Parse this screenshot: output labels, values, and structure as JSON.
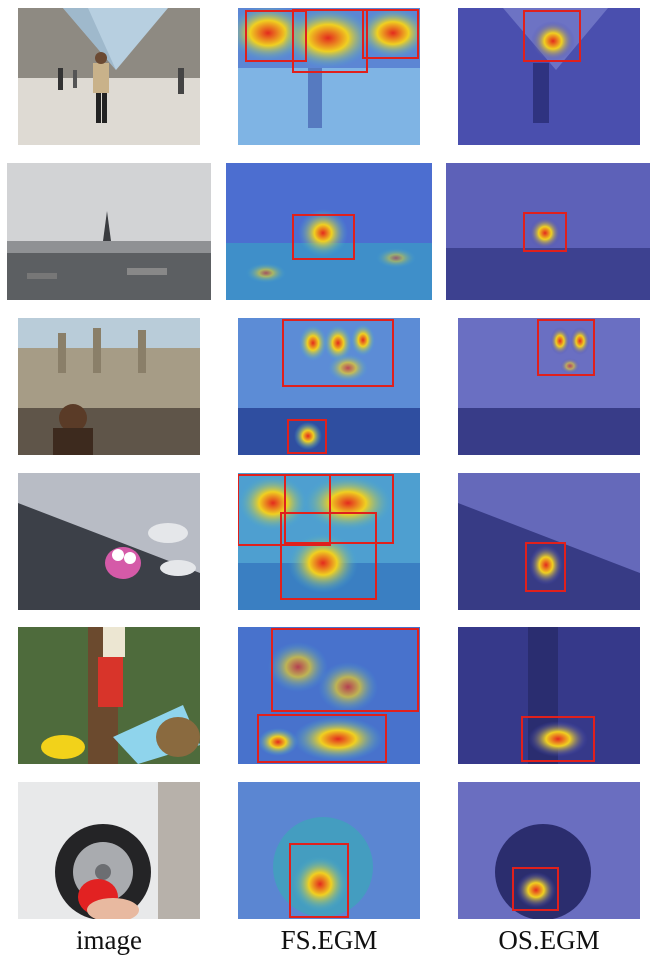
{
  "columns": [
    {
      "id": "image",
      "label_main": "image",
      "label_sc": ""
    },
    {
      "id": "fs",
      "label_main": "FS.",
      "label_sc": "EGM"
    },
    {
      "id": "os",
      "label_main": "OS.",
      "label_sc": "EGM"
    }
  ],
  "rows": [
    {
      "scene": "louvre-pyramid-hall",
      "fs_boxes": 3,
      "os_boxes": 1
    },
    {
      "scene": "eiffel-tower-cityscape",
      "fs_boxes": 1,
      "os_boxes": 1
    },
    {
      "scene": "oxford-spires-girl",
      "fs_boxes": 2,
      "os_boxes": 1
    },
    {
      "scene": "water-drops-sticker",
      "fs_boxes": 3,
      "os_boxes": 1
    },
    {
      "scene": "flowers-and-sign",
      "fs_boxes": 2,
      "os_boxes": 1
    },
    {
      "scene": "car-wheel-toy",
      "fs_boxes": 1,
      "os_boxes": 1
    }
  ],
  "colors": {
    "box": "#e0201c",
    "overlay_blue": "#3a44c8",
    "heat_hot": "#e32b1e",
    "heat_warm": "#f0d021"
  }
}
